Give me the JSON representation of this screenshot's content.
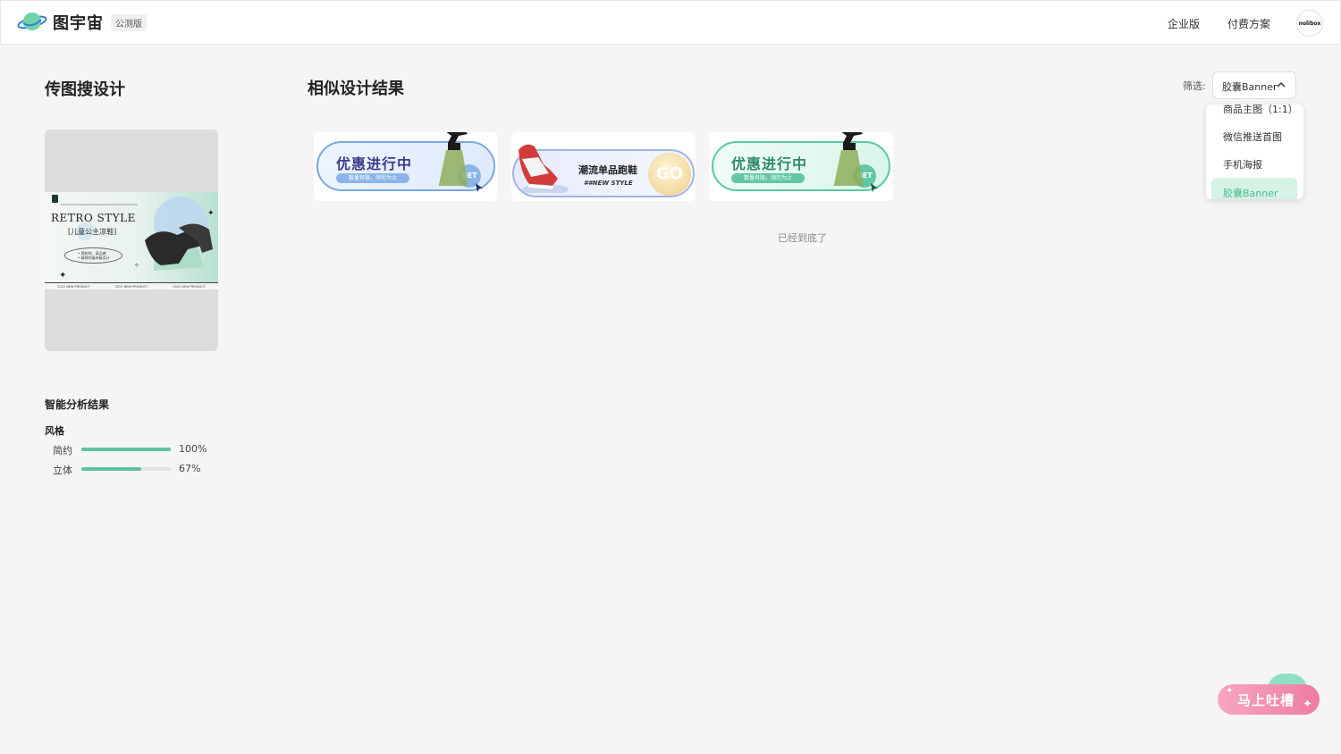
{
  "header": {
    "brand": "图宇宙",
    "badge": "公测版",
    "nav": [
      "企业版",
      "付费方案"
    ],
    "avatar_text": "nolibox"
  },
  "left": {
    "title": "传图搜设计",
    "upload_image": {
      "title": "RETRO STYLE",
      "subtitle": "[儿童公主凉鞋]",
      "pill_lines": [
        "• 简构你、高品感",
        "• 精致的毫米级设计"
      ],
      "footer": [
        "2022 NEW PRODUCT",
        "2022 NEW PRODUCT",
        "2022 NEW PRODUCT"
      ]
    },
    "analysis": {
      "title": "智能分析结果",
      "style_label": "风格",
      "bars": [
        {
          "name": "简约",
          "value": 100,
          "pct": "100%"
        },
        {
          "name": "立体",
          "value": 67,
          "pct": "67%"
        }
      ]
    }
  },
  "main": {
    "title": "相似设计结果",
    "filter": {
      "label": "筛选:",
      "selected": "胶囊Banner",
      "options": [
        "商品主图（1:1）",
        "微信推送首图",
        "手机海报",
        "胶囊Banner"
      ]
    },
    "cards": [
      {
        "title": "优惠进行中",
        "tag": "数量有限，领完为止",
        "button": "GET",
        "theme": "blue"
      },
      {
        "title": "潮流单品跑鞋",
        "tag": "##NEW STYLE",
        "button": "GO",
        "theme": "shoe"
      },
      {
        "title": "优惠进行中",
        "tag": "数量有限，领完为止",
        "button": "GET",
        "theme": "green"
      }
    ],
    "end_text": "已经到底了"
  },
  "feedback": {
    "label": "马上吐槽"
  },
  "colors": {
    "accent": "#5cc29f",
    "feedback_pink": "#ee7da1"
  }
}
